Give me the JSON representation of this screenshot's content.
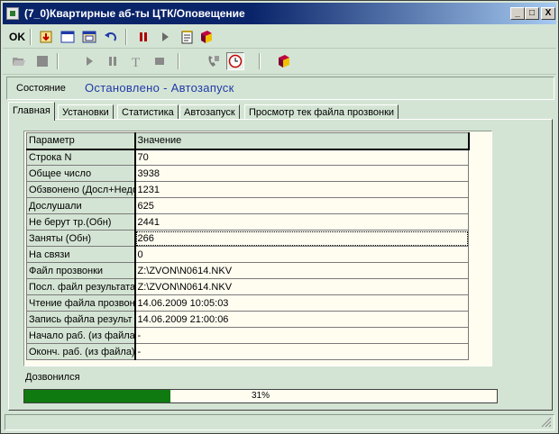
{
  "window": {
    "title": "(7_0)Квартирные аб-ты ЦТК/Оповещение",
    "minimize": "_",
    "maximize": "□",
    "close": "X"
  },
  "toolbar1": {
    "ok_label": "OK",
    "icons": [
      "download-icon",
      "window-icon",
      "window-alt-icon",
      "undo-icon",
      "pause-icon",
      "play-icon",
      "notepad-icon",
      "book-icon"
    ]
  },
  "toolbar2": {
    "icons": [
      "open-folder-icon",
      "stop-icon",
      "play-icon",
      "pause-icon",
      "text-icon",
      "stop-alt-icon",
      "phone-icon",
      "clock-icon",
      "book-icon"
    ]
  },
  "status": {
    "label": "Состояние",
    "value": "Остановлено - Автозапуск"
  },
  "tabs": [
    {
      "label": "Главная",
      "active": true
    },
    {
      "label": "Установки",
      "active": false
    },
    {
      "label": "Статистика",
      "active": false
    },
    {
      "label": "Автозапуск",
      "active": false
    },
    {
      "label": "Просмотр тек файла прозвонки",
      "active": false
    }
  ],
  "grid": {
    "headers": [
      "Параметр",
      "Значение"
    ],
    "rows": [
      {
        "param": "Строка N",
        "value": "70"
      },
      {
        "param": "Общее число",
        "value": "3938"
      },
      {
        "param": "Обзвонено (Досл+Недо",
        "value": "1231"
      },
      {
        "param": "Дослушали",
        "value": "625"
      },
      {
        "param": "Не берут тр.(Обн)",
        "value": "2441"
      },
      {
        "param": "Заняты (Обн)",
        "value": "266"
      },
      {
        "param": "На связи",
        "value": "0"
      },
      {
        "param": "Файл прозвонки",
        "value": "Z:\\ZVON\\N0614.NKV"
      },
      {
        "param": "Посл. файл результата",
        "value": "Z:\\ZVON\\N0614.NKV"
      },
      {
        "param": "Чтение файла прозвон",
        "value": "14.06.2009 10:05:03"
      },
      {
        "param": "Запись файла результ",
        "value": "14.06.2009 21:00:06"
      },
      {
        "param": "Начало раб. (из файла)",
        "value": "-"
      },
      {
        "param": "Оконч. раб. (из файла)",
        "value": "-"
      }
    ],
    "selected_row": 5
  },
  "progress": {
    "label": "Дозвонился",
    "percent_text": "31%",
    "fraction": 0.31,
    "fill_color": "#0f7a0f"
  }
}
